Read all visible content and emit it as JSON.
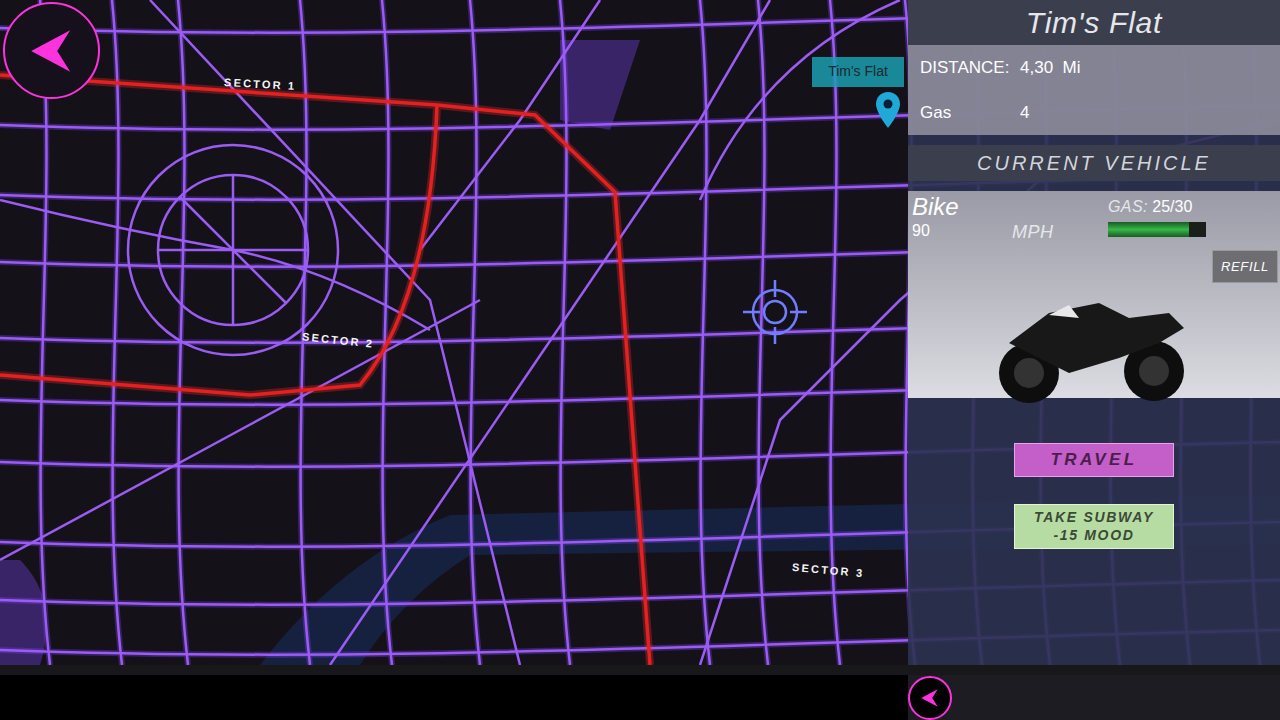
{
  "map": {
    "sectors": [
      {
        "label": "SECTOR 1"
      },
      {
        "label": "SECTOR 2"
      },
      {
        "label": "SECTOR 3"
      }
    ],
    "destination": {
      "label": "Tim's Flat"
    }
  },
  "panel": {
    "title": "Tim's Flat",
    "stats": [
      {
        "label": "DISTANCE:",
        "value": "4,30  Mi"
      },
      {
        "label": "Gas",
        "value": "4"
      }
    ]
  },
  "vehicle": {
    "header": "CURRENT VEHICLE",
    "name": "Bike",
    "speed": "90",
    "speed_unit": "MPH",
    "gas_label": "GAS:",
    "gas_reading": "25/30",
    "level": 0.83,
    "refill": "REFILL"
  },
  "actions": {
    "travel": "TRAVEL",
    "subway": [
      "TAKE SUBWAY",
      "-15 MOOD"
    ]
  }
}
